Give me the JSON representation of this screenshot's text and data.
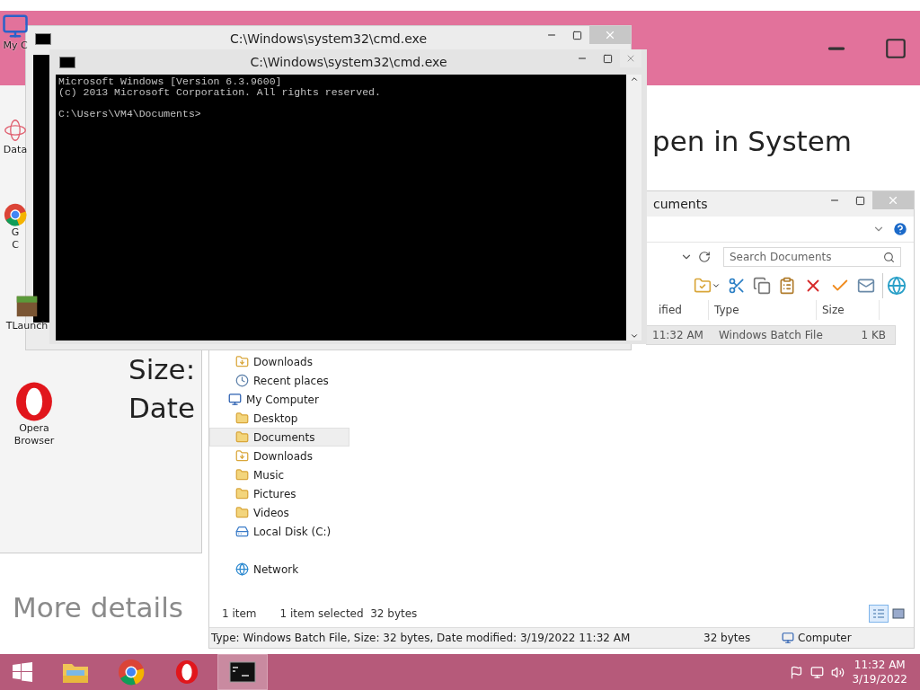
{
  "background_window": {
    "heading": "pen in System",
    "fields": [
      "Size:",
      "Date"
    ],
    "link": "More details"
  },
  "desktop_icons": [
    {
      "kind": "computer",
      "label": [
        "My C"
      ]
    },
    {
      "kind": "database",
      "label": [
        "Data"
      ]
    },
    {
      "kind": "chrome",
      "label": [
        "G",
        "C"
      ]
    },
    {
      "kind": "block",
      "label": [
        "TLaunch"
      ]
    },
    {
      "kind": "opera",
      "label": [
        "Opera",
        "Browser"
      ]
    }
  ],
  "explorer": {
    "title": "cuments",
    "search": {
      "placeholder": "Search Documents"
    },
    "columns": [
      "ified",
      "Type",
      "Size"
    ],
    "rows": [
      {
        "cells": [
          "11:32 AM",
          "Windows Batch File",
          "1 KB"
        ],
        "selected": true
      }
    ],
    "nav": [
      {
        "label": "Downloads",
        "kind": "downloads",
        "selected": false
      },
      {
        "label": "Recent places",
        "kind": "recent",
        "selected": false
      },
      {
        "label": "My Computer",
        "kind": "computer",
        "selected": false,
        "children": [
          {
            "label": "Desktop",
            "kind": "folder",
            "selected": false
          },
          {
            "label": "Documents",
            "kind": "folder",
            "selected": true
          },
          {
            "label": "Downloads",
            "kind": "downloads",
            "selected": false
          },
          {
            "label": "Music",
            "kind": "folder",
            "selected": false
          },
          {
            "label": "Pictures",
            "kind": "folder",
            "selected": false
          },
          {
            "label": "Videos",
            "kind": "folder",
            "selected": false
          },
          {
            "label": "Local Disk (C:)",
            "kind": "disk",
            "selected": false
          }
        ]
      },
      {
        "label": "Network",
        "kind": "network",
        "selected": false
      }
    ],
    "footer": {
      "count": "1 item",
      "selection": "1 item selected  32 bytes"
    },
    "views": [
      {
        "kind": "details",
        "selected": true
      },
      {
        "kind": "preview",
        "selected": false
      }
    ],
    "status": {
      "details": "Type: Windows Batch File, Size: 32 bytes, Date modified: 3/19/2022 11:32 AM",
      "size": "32 bytes",
      "zone": "Computer"
    }
  },
  "cmd": {
    "outer_title": "C:\\Windows\\system32\\cmd.exe",
    "title": "C:\\Windows\\system32\\cmd.exe",
    "paragraphs": [
      [
        "Microsoft Windows [Version 6.3.9600]",
        "(c) 2013 Microsoft Corporation. All rights reserved."
      ],
      [
        "C:\\Users\\VM4\\Documents>"
      ]
    ]
  },
  "taskbar": {
    "apps": [
      {
        "kind": "explorer",
        "active": false
      },
      {
        "kind": "chrome",
        "active": false
      },
      {
        "kind": "opera",
        "active": false
      },
      {
        "kind": "console",
        "active": true
      }
    ],
    "time": "11:32 AM",
    "date": "3/19/2022"
  }
}
